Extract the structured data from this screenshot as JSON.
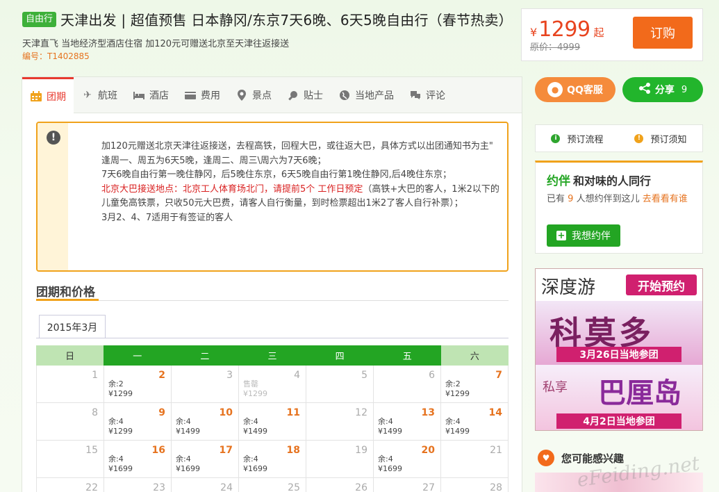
{
  "header": {
    "tag": "自由行",
    "title": "天津出发 | 超值预售 日本静冈/东京7天6晚、6天5晚自由行（春节热卖）",
    "subtitle": "天津直飞 当地经济型酒店住宿 加120元可赠送北京至天津往返接送",
    "code_label": "编号：",
    "code_value": "T1402885"
  },
  "price": {
    "currency": "¥",
    "value": "1299",
    "suffix": "起",
    "original": "原价：4999",
    "order_label": "订购"
  },
  "tabs": [
    {
      "label": "团期",
      "icon": "calendar-icon"
    },
    {
      "label": "航班",
      "icon": "plane-icon"
    },
    {
      "label": "酒店",
      "icon": "bed-icon"
    },
    {
      "label": "费用",
      "icon": "wallet-icon"
    },
    {
      "label": "景点",
      "icon": "location-pin-icon"
    },
    {
      "label": "贴士",
      "icon": "magnifier-icon"
    },
    {
      "label": "当地产品",
      "icon": "globe-icon"
    },
    {
      "label": "评论",
      "icon": "comment-icon"
    }
  ],
  "notice": {
    "line1": "加120元赠送北京天津往返接送，去程高铁，回程大巴，或往返大巴，具体方式以出团通知书为主\"",
    "line2": "逢周一、周五为6天5晚，逢周二、周三\\周六为7天6晚；",
    "line3": "7天6晚自由行第一晚住静冈，后5晚住东京，6天5晚自由行第1晚住静冈,后4晚住东京；",
    "line4_red": "北京大巴接送地点：北京工人体育场北门，请提前5个 工作日预定",
    "line4_rest": "（高铁+大巴的客人，1米2以下的儿童免高铁票，只收50元大巴费，请客人自行衡量，到时检票超出1米2了客人自行补票）；",
    "line5": "3月2、4、7适用于有签证的客人"
  },
  "section_title": "团期和价格",
  "calendar": {
    "month": "2015年3月",
    "headers": [
      "日",
      "一",
      "二",
      "三",
      "四",
      "五",
      "六"
    ],
    "rows": [
      [
        {
          "d": "1",
          "a": false
        },
        {
          "d": "2",
          "a": true,
          "s": "余:2",
          "p": "¥1299"
        },
        {
          "d": "3",
          "a": false
        },
        {
          "d": "4",
          "a": false,
          "sold": true,
          "s": "售罄",
          "p": "¥1299"
        },
        {
          "d": "5",
          "a": false
        },
        {
          "d": "6",
          "a": false
        },
        {
          "d": "7",
          "a": true,
          "s": "余:2",
          "p": "¥1299"
        }
      ],
      [
        {
          "d": "8",
          "a": false
        },
        {
          "d": "9",
          "a": true,
          "s": "余:4",
          "p": "¥1299"
        },
        {
          "d": "10",
          "a": true,
          "s": "余:4",
          "p": "¥1499"
        },
        {
          "d": "11",
          "a": true,
          "s": "余:4",
          "p": "¥1499"
        },
        {
          "d": "12",
          "a": false
        },
        {
          "d": "13",
          "a": true,
          "s": "余:4",
          "p": "¥1499"
        },
        {
          "d": "14",
          "a": true,
          "s": "余:4",
          "p": "¥1499"
        }
      ],
      [
        {
          "d": "15",
          "a": false
        },
        {
          "d": "16",
          "a": true,
          "s": "余:4",
          "p": "¥1699"
        },
        {
          "d": "17",
          "a": true,
          "s": "余:4",
          "p": "¥1699"
        },
        {
          "d": "18",
          "a": true,
          "s": "余:4",
          "p": "¥1699"
        },
        {
          "d": "19",
          "a": false
        },
        {
          "d": "20",
          "a": true,
          "s": "余:4",
          "p": "¥1699"
        },
        {
          "d": "21",
          "a": false
        }
      ],
      [
        {
          "d": "22",
          "a": false
        },
        {
          "d": "23",
          "a": false
        },
        {
          "d": "24",
          "a": false
        },
        {
          "d": "25",
          "a": false
        },
        {
          "d": "26",
          "a": false
        },
        {
          "d": "27",
          "a": false
        },
        {
          "d": "28",
          "a": false
        }
      ]
    ]
  },
  "sidebar": {
    "qq_label": "QQ客服",
    "share_label": "分享",
    "share_count": "9",
    "process_label": "预订流程",
    "notice_label": "预订须知",
    "yueban_logo_a": "约",
    "yueban_logo_b": "伴",
    "yueban_title": "和对味的人同行",
    "yueban_pre": "已有",
    "yueban_count": "9",
    "yueban_mid": "人想约伴到这儿",
    "yueban_link": "去看看有谁",
    "yueban_btn": "我想约伴",
    "ad_brand": "深度游",
    "ad_preorder": "开始预约",
    "ad_big1": "科莫多",
    "ad_strip1": "3月26日当地参团",
    "ad_small": "私享",
    "ad_big2": "巴厘岛",
    "ad_strip2": "4月2日当地参团",
    "interest_title": "您可能感兴趣",
    "watermark": "eFeiding.net"
  }
}
